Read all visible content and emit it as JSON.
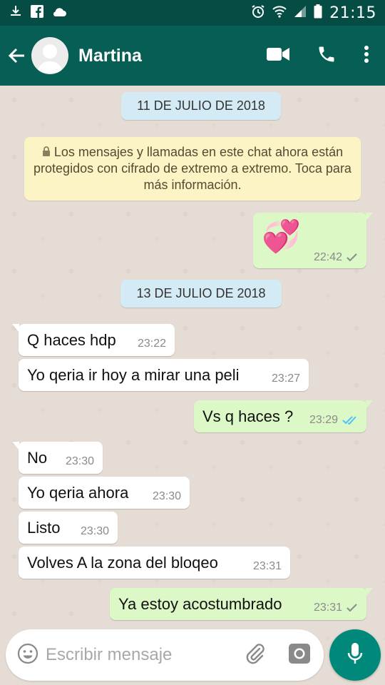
{
  "status_bar": {
    "time": "21:15"
  },
  "app_bar": {
    "contact_name": "Martina"
  },
  "chat": {
    "date_1": "11 DE JULIO DE 2018",
    "encryption_notice": "Los mensajes y llamadas en este chat ahora están protegidos con cifrado de extremo a extremo. Toca para más información.",
    "date_2": "13 DE JULIO DE 2018",
    "messages": [
      {
        "direction": "out",
        "text": "💞",
        "time": "22:42",
        "status": "sent"
      },
      {
        "direction": "in",
        "text": "Q haces hdp",
        "time": "23:22"
      },
      {
        "direction": "in",
        "text": "Yo qeria ir hoy a mirar una peli",
        "time": "23:27"
      },
      {
        "direction": "out",
        "text": "Vs q haces ?",
        "time": "23:29",
        "status": "read"
      },
      {
        "direction": "in",
        "text": "No",
        "time": "23:30"
      },
      {
        "direction": "in",
        "text": "Yo qeria ahora",
        "time": "23:30"
      },
      {
        "direction": "in",
        "text": "Listo",
        "time": "23:30"
      },
      {
        "direction": "in",
        "text": "Volves A la zona del bloqeo",
        "time": "23:31"
      },
      {
        "direction": "out",
        "text": "Ya estoy acostumbrado",
        "time": "23:31",
        "status": "sent"
      }
    ]
  },
  "input_bar": {
    "placeholder": "Escribir mensaje"
  },
  "colors": {
    "header": "#075e54",
    "status_bar": "#054d44",
    "outgoing": "#dcf8c6",
    "incoming": "#ffffff",
    "read_tick": "#4fc3f7",
    "fab": "#00897b"
  }
}
